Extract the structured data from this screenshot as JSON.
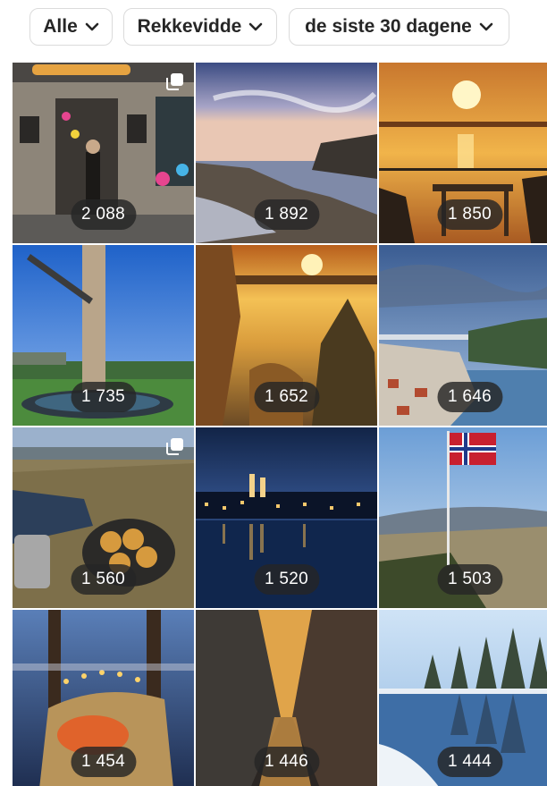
{
  "filters": [
    {
      "label": "Alle",
      "icon": "chevron-down-icon"
    },
    {
      "label": "Rekkevidde",
      "icon": "chevron-down-icon"
    },
    {
      "label": "de siste 30 dagene",
      "icon": "chevron-down-icon"
    }
  ],
  "posts": [
    {
      "reach": "2 088",
      "scene": "storefront",
      "multi": true
    },
    {
      "reach": "1 892",
      "scene": "coast-dusk",
      "multi": false
    },
    {
      "reach": "1 850",
      "scene": "sunset-terrace",
      "multi": false
    },
    {
      "reach": "1 735",
      "scene": "sculpture",
      "multi": false
    },
    {
      "reach": "1 652",
      "scene": "golden-lake",
      "multi": false
    },
    {
      "reach": "1 646",
      "scene": "harbor-town",
      "multi": false
    },
    {
      "reach": "1 560",
      "scene": "campfire-buns",
      "multi": true
    },
    {
      "reach": "1 520",
      "scene": "night-city",
      "multi": false
    },
    {
      "reach": "1 503",
      "scene": "flag-hill",
      "multi": false
    },
    {
      "reach": "1 454",
      "scene": "hammock-lights",
      "multi": false
    },
    {
      "reach": "1 446",
      "scene": "canyon-reflection",
      "multi": false
    },
    {
      "reach": "1 444",
      "scene": "winter-lake",
      "multi": false
    }
  ],
  "colors": {
    "badge": "#262626",
    "chip_border": "#dbdbdb",
    "text": "#262626"
  }
}
